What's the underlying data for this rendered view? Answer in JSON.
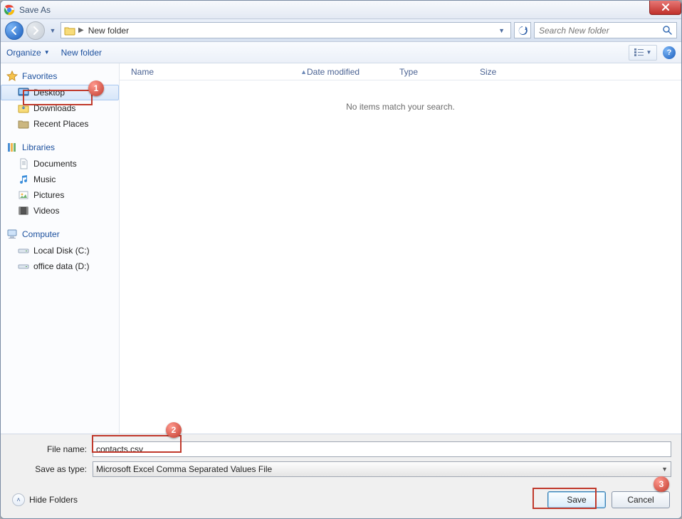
{
  "window": {
    "title": "Save As"
  },
  "nav": {
    "path_label": "New folder",
    "search_placeholder": "Search New folder"
  },
  "toolbar": {
    "organize": "Organize",
    "new_folder": "New folder"
  },
  "sidebar": {
    "favorites": {
      "header": "Favorites",
      "items": [
        "Desktop",
        "Downloads",
        "Recent Places"
      ]
    },
    "libraries": {
      "header": "Libraries",
      "items": [
        "Documents",
        "Music",
        "Pictures",
        "Videos"
      ]
    },
    "computer": {
      "header": "Computer",
      "items": [
        "Local Disk (C:)",
        "office data (D:)"
      ]
    }
  },
  "columns": {
    "name": "Name",
    "date": "Date modified",
    "type": "Type",
    "size": "Size"
  },
  "empty_text": "No items match your search.",
  "form": {
    "file_name_label": "File name:",
    "file_name_value": "contacts.csv",
    "save_type_label": "Save as type:",
    "save_type_value": "Microsoft Excel Comma Separated Values File"
  },
  "buttons": {
    "hide_folders": "Hide Folders",
    "save": "Save",
    "cancel": "Cancel"
  },
  "callouts": {
    "one": "1",
    "two": "2",
    "three": "3"
  }
}
